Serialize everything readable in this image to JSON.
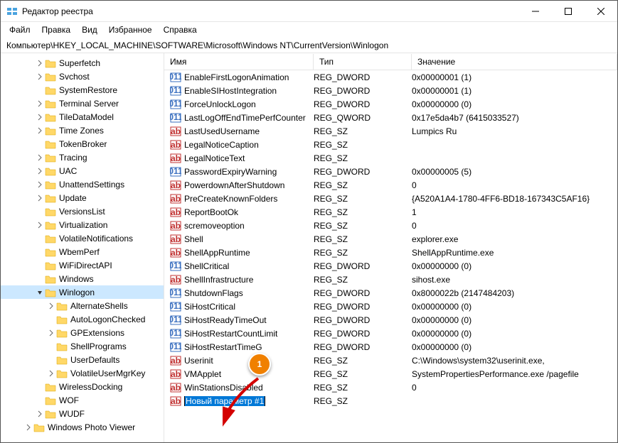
{
  "title": "Редактор реестра",
  "menu": [
    "Файл",
    "Правка",
    "Вид",
    "Избранное",
    "Справка"
  ],
  "address": "Компьютер\\HKEY_LOCAL_MACHINE\\SOFTWARE\\Microsoft\\Windows NT\\CurrentVersion\\Winlogon",
  "columns": {
    "name": "Имя",
    "type": "Тип",
    "value": "Значение"
  },
  "tree": [
    {
      "label": "Superfetch",
      "indent": 3,
      "tw": ">"
    },
    {
      "label": "Svchost",
      "indent": 3,
      "tw": ">"
    },
    {
      "label": "SystemRestore",
      "indent": 3,
      "tw": ""
    },
    {
      "label": "Terminal Server",
      "indent": 3,
      "tw": ">"
    },
    {
      "label": "TileDataModel",
      "indent": 3,
      "tw": ">"
    },
    {
      "label": "Time Zones",
      "indent": 3,
      "tw": ">"
    },
    {
      "label": "TokenBroker",
      "indent": 3,
      "tw": ""
    },
    {
      "label": "Tracing",
      "indent": 3,
      "tw": ">"
    },
    {
      "label": "UAC",
      "indent": 3,
      "tw": ">"
    },
    {
      "label": "UnattendSettings",
      "indent": 3,
      "tw": ">"
    },
    {
      "label": "Update",
      "indent": 3,
      "tw": ">"
    },
    {
      "label": "VersionsList",
      "indent": 3,
      "tw": ""
    },
    {
      "label": "Virtualization",
      "indent": 3,
      "tw": ">"
    },
    {
      "label": "VolatileNotifications",
      "indent": 3,
      "tw": ""
    },
    {
      "label": "WbemPerf",
      "indent": 3,
      "tw": ""
    },
    {
      "label": "WiFiDirectAPI",
      "indent": 3,
      "tw": ""
    },
    {
      "label": "Windows",
      "indent": 3,
      "tw": ""
    },
    {
      "label": "Winlogon",
      "indent": 3,
      "tw": "v",
      "selected": true
    },
    {
      "label": "AlternateShells",
      "indent": 4,
      "tw": ">"
    },
    {
      "label": "AutoLogonChecked",
      "indent": 4,
      "tw": ""
    },
    {
      "label": "GPExtensions",
      "indent": 4,
      "tw": ">"
    },
    {
      "label": "ShellPrograms",
      "indent": 4,
      "tw": ""
    },
    {
      "label": "UserDefaults",
      "indent": 4,
      "tw": ""
    },
    {
      "label": "VolatileUserMgrKey",
      "indent": 4,
      "tw": ">"
    },
    {
      "label": "WirelessDocking",
      "indent": 3,
      "tw": ""
    },
    {
      "label": "WOF",
      "indent": 3,
      "tw": ""
    },
    {
      "label": "WUDF",
      "indent": 3,
      "tw": ">"
    },
    {
      "label": "Windows Photo Viewer",
      "indent": 2,
      "tw": ">"
    }
  ],
  "rows": [
    {
      "icon": "bin",
      "name": "EnableFirstLogonAnimation",
      "type": "REG_DWORD",
      "value": "0x00000001 (1)"
    },
    {
      "icon": "bin",
      "name": "EnableSIHostIntegration",
      "type": "REG_DWORD",
      "value": "0x00000001 (1)"
    },
    {
      "icon": "bin",
      "name": "ForceUnlockLogon",
      "type": "REG_DWORD",
      "value": "0x00000000 (0)"
    },
    {
      "icon": "bin",
      "name": "LastLogOffEndTimePerfCounter",
      "type": "REG_QWORD",
      "value": "0x17e5da4b7 (6415033527)"
    },
    {
      "icon": "sz",
      "name": "LastUsedUsername",
      "type": "REG_SZ",
      "value": "Lumpics Ru"
    },
    {
      "icon": "sz",
      "name": "LegalNoticeCaption",
      "type": "REG_SZ",
      "value": ""
    },
    {
      "icon": "sz",
      "name": "LegalNoticeText",
      "type": "REG_SZ",
      "value": ""
    },
    {
      "icon": "bin",
      "name": "PasswordExpiryWarning",
      "type": "REG_DWORD",
      "value": "0x00000005 (5)"
    },
    {
      "icon": "sz",
      "name": "PowerdownAfterShutdown",
      "type": "REG_SZ",
      "value": "0"
    },
    {
      "icon": "sz",
      "name": "PreCreateKnownFolders",
      "type": "REG_SZ",
      "value": "{A520A1A4-1780-4FF6-BD18-167343C5AF16}"
    },
    {
      "icon": "sz",
      "name": "ReportBootOk",
      "type": "REG_SZ",
      "value": "1"
    },
    {
      "icon": "sz",
      "name": "scremoveoption",
      "type": "REG_SZ",
      "value": "0"
    },
    {
      "icon": "sz",
      "name": "Shell",
      "type": "REG_SZ",
      "value": "explorer.exe"
    },
    {
      "icon": "sz",
      "name": "ShellAppRuntime",
      "type": "REG_SZ",
      "value": "ShellAppRuntime.exe"
    },
    {
      "icon": "bin",
      "name": "ShellCritical",
      "type": "REG_DWORD",
      "value": "0x00000000 (0)"
    },
    {
      "icon": "sz",
      "name": "ShellInfrastructure",
      "type": "REG_SZ",
      "value": "sihost.exe"
    },
    {
      "icon": "bin",
      "name": "ShutdownFlags",
      "type": "REG_DWORD",
      "value": "0x8000022b (2147484203)"
    },
    {
      "icon": "bin",
      "name": "SiHostCritical",
      "type": "REG_DWORD",
      "value": "0x00000000 (0)"
    },
    {
      "icon": "bin",
      "name": "SiHostReadyTimeOut",
      "type": "REG_DWORD",
      "value": "0x00000000 (0)"
    },
    {
      "icon": "bin",
      "name": "SiHostRestartCountLimit",
      "type": "REG_DWORD",
      "value": "0x00000000 (0)"
    },
    {
      "icon": "bin",
      "name": "SiHostRestartTimeGap",
      "type": "REG_DWORD",
      "value": "0x00000000 (0)",
      "nameClipped": "SiHostRestartTimeG"
    },
    {
      "icon": "sz",
      "name": "Userinit",
      "type": "REG_SZ",
      "value": "C:\\Windows\\system32\\userinit.exe,"
    },
    {
      "icon": "sz",
      "name": "VMApplet",
      "type": "REG_SZ",
      "value": "SystemPropertiesPerformance.exe /pagefile"
    },
    {
      "icon": "sz",
      "name": "WinStationsDisabled",
      "type": "REG_SZ",
      "value": "0"
    },
    {
      "icon": "sz",
      "name": "Новый параметр #1",
      "type": "REG_SZ",
      "value": "",
      "editing": true
    }
  ],
  "callout": "1"
}
